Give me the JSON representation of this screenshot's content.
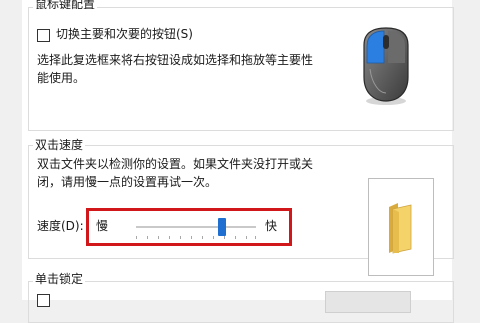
{
  "buttons_section": {
    "title": "鼠标键配置",
    "checkbox_label": "切换主要和次要的按钮(S)",
    "checkbox_checked": false,
    "description_line1": "选择此复选框来将右按钮设成如选择和拖放等主要性",
    "description_line2": "能使用。",
    "icon": "mouse-icon"
  },
  "double_click_section": {
    "title": "双击速度",
    "description_line1": "双击文件夹以检测你的设置。如果文件夹没打开或关",
    "description_line2": "闭，请用慢一点的设置再试一次。",
    "speed_label": "速度(D):",
    "slow_label": "慢",
    "fast_label": "快",
    "speed_value": 0.72,
    "test_icon": "folder-icon",
    "highlight_color": "#d2171b"
  },
  "click_lock_section": {
    "title": "单击锁定"
  }
}
